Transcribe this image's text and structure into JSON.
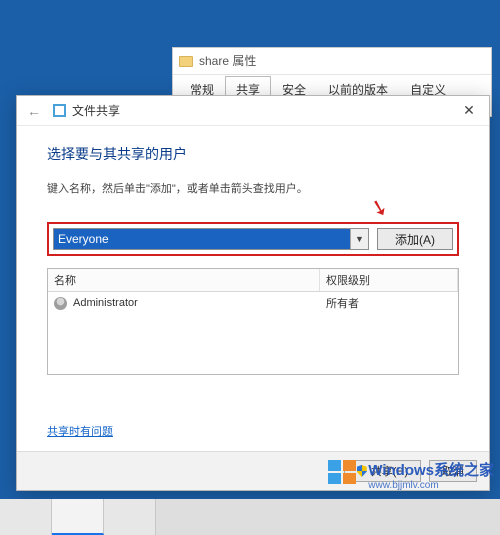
{
  "props": {
    "title": "share 属性",
    "tabs": [
      "常规",
      "共享",
      "安全",
      "以前的版本",
      "自定义"
    ],
    "active_tab_index": 1
  },
  "share": {
    "header_title": "文件共享",
    "heading": "选择要与其共享的用户",
    "instruction": "键入名称，然后单击\"添加\"，或者单击箭头查找用户。",
    "combo_value": "Everyone",
    "add_button": "添加(A)",
    "columns": {
      "name": "名称",
      "perm": "权限级别"
    },
    "rows": [
      {
        "name": "Administrator",
        "perm": "所有者"
      }
    ],
    "help_link": "共享时有问题",
    "footer": {
      "share": "共享(H)",
      "cancel": "取消"
    }
  },
  "watermark": {
    "brand": "Windows系统之家",
    "url": "www.bjjmlv.com"
  }
}
